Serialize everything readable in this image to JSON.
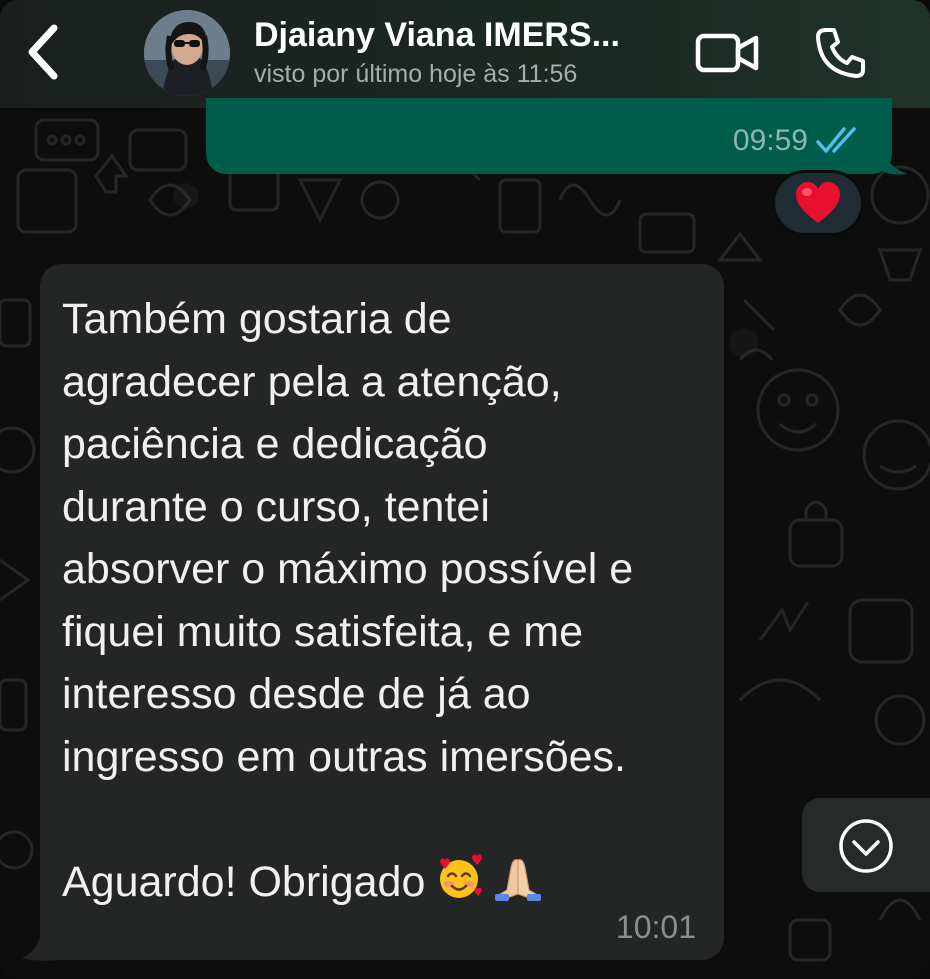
{
  "header": {
    "contact_name": "Djaiany Viana IMERS...",
    "last_seen": "visto por último hoje às 11:56",
    "icons": {
      "back": "chevron-left-icon",
      "avatar": "contact-avatar",
      "video": "video-camera-icon",
      "call": "phone-icon"
    }
  },
  "messages": {
    "outgoing": {
      "time": "09:59",
      "status_icon": "double-check-read-icon",
      "status_color": "#53bdeb",
      "reaction": "❤️"
    },
    "incoming": {
      "lines": [
        "Também gostaria de",
        "agradecer pela a atenção,",
        "paciência e dedicação",
        "durante o curso, tentei",
        "absorver o máximo possível e",
        "fiquei muito satisfeita, e me",
        "interesso desde de já ao",
        "ingresso em outras imersões."
      ],
      "closing": "Aguardo! Obrigado",
      "closing_emoji": [
        "smiling-face-with-hearts-icon",
        "folded-hands-icon"
      ],
      "time": "10:01"
    }
  },
  "controls": {
    "scroll_down_icon": "chevron-down-circle-icon"
  },
  "colors": {
    "header_bg": "#1c2823",
    "outgoing_bubble": "#005c4b",
    "incoming_bubble": "#242626",
    "wallpaper": "#0d0d0d",
    "read_receipt": "#53bdeb"
  }
}
